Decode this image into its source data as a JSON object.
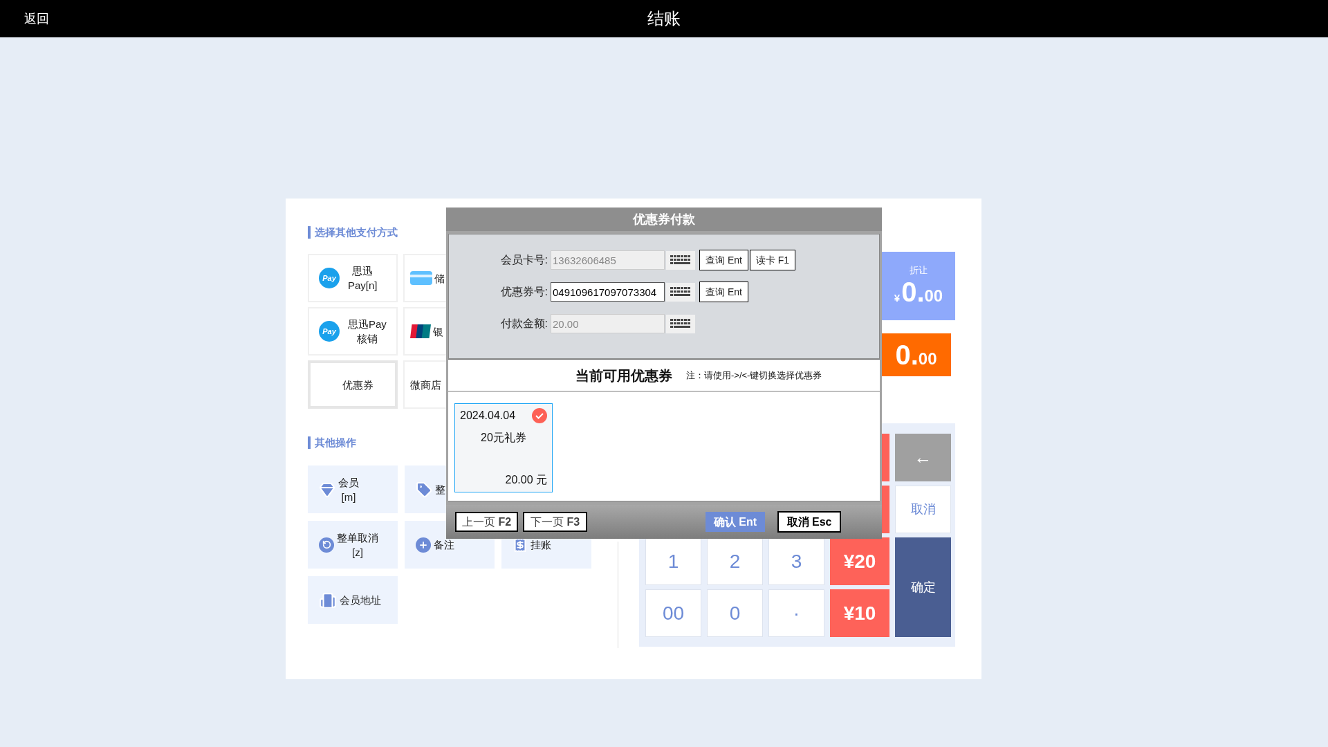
{
  "top_bar": {
    "back": "返回",
    "title": "结账"
  },
  "payment_section": {
    "title": "选择其他支付方式",
    "methods": [
      {
        "kind": "pay",
        "icon_text": "Pay",
        "lines": [
          "思迅",
          "Pay[n]"
        ],
        "selected": false
      },
      {
        "kind": "card",
        "lines": [
          "储"
        ],
        "selected": false
      },
      {
        "kind": "pay",
        "icon_text": "Pay",
        "lines": [
          "思迅Pay",
          "核销"
        ],
        "selected": false
      },
      {
        "kind": "unionpay",
        "lines": [
          "银"
        ],
        "selected": false
      },
      {
        "kind": "text",
        "lines": [
          "优惠券"
        ],
        "selected": true
      },
      {
        "kind": "text",
        "lines": [
          "微商店"
        ],
        "selected": false
      }
    ]
  },
  "operations_section": {
    "title": "其他操作",
    "rows": [
      [
        {
          "kind": "member",
          "lines": [
            "会员",
            "[m]"
          ]
        },
        {
          "kind": "discount",
          "lines": [
            "整"
          ]
        }
      ],
      [
        {
          "kind": "void",
          "lines": [
            "整单取消",
            "[z]"
          ]
        },
        {
          "kind": "note",
          "lines": [
            "备注"
          ]
        },
        {
          "kind": "credit",
          "lines": [
            "挂账"
          ]
        }
      ],
      [
        {
          "kind": "address",
          "lines": [
            "会员地址"
          ]
        }
      ]
    ]
  },
  "discount": {
    "label": "折让",
    "currency": "¥",
    "amount": "0.00"
  },
  "due": {
    "amount": "0.00"
  },
  "keypad": [
    {
      "kind": "backspace",
      "label": "←"
    },
    {
      "kind": "cancel",
      "label": "取消"
    },
    {
      "kind": "digit",
      "label": "1"
    },
    {
      "kind": "digit",
      "label": "2"
    },
    {
      "kind": "digit",
      "label": "3"
    },
    {
      "kind": "cash",
      "label": "¥20"
    },
    {
      "kind": "confirm",
      "label": "确定"
    },
    {
      "kind": "digit",
      "label": "00"
    },
    {
      "kind": "digit",
      "label": "0"
    },
    {
      "kind": "digit",
      "label": "·"
    },
    {
      "kind": "cash",
      "label": "¥10"
    }
  ],
  "coupon_dialog": {
    "title": "优惠券付款",
    "fields": [
      {
        "label": "会员卡号:",
        "value": "13632606485",
        "disabled": true,
        "buttons": [
          "查询 Ent",
          "读卡 F1"
        ]
      },
      {
        "label": "优惠券号:",
        "value": "049109617097073304",
        "disabled": false,
        "buttons": [
          "查询 Ent"
        ]
      },
      {
        "label": "付款金额:",
        "value": "20.00",
        "disabled": true
      }
    ],
    "list_title": "当前可用优惠券",
    "hint": "注：请使用->/<-键切换选择优惠券",
    "coupons": [
      {
        "date": "2024.04.04",
        "name": "20元礼券",
        "amount": "20.00 元",
        "selected": true
      }
    ],
    "prev": "上一页 **F2**",
    "next": "下一页 **F3**",
    "confirm": "确认 Ent",
    "cancel": "取消 Esc"
  }
}
